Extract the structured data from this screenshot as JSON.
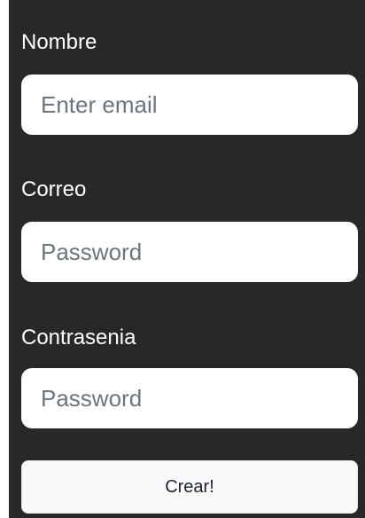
{
  "form": {
    "fields": [
      {
        "label": "Nombre",
        "placeholder": "Enter email",
        "value": ""
      },
      {
        "label": "Correo",
        "placeholder": "Password",
        "value": ""
      },
      {
        "label": "Contrasenia",
        "placeholder": "Password",
        "value": ""
      }
    ],
    "submit_label": "Crear!"
  },
  "colors": {
    "panel_background": "#282828",
    "page_background": "#ffffff",
    "input_background": "#ffffff",
    "button_background": "#f8f9fa",
    "label_text": "#ffffff",
    "placeholder_text": "#6c757d"
  }
}
